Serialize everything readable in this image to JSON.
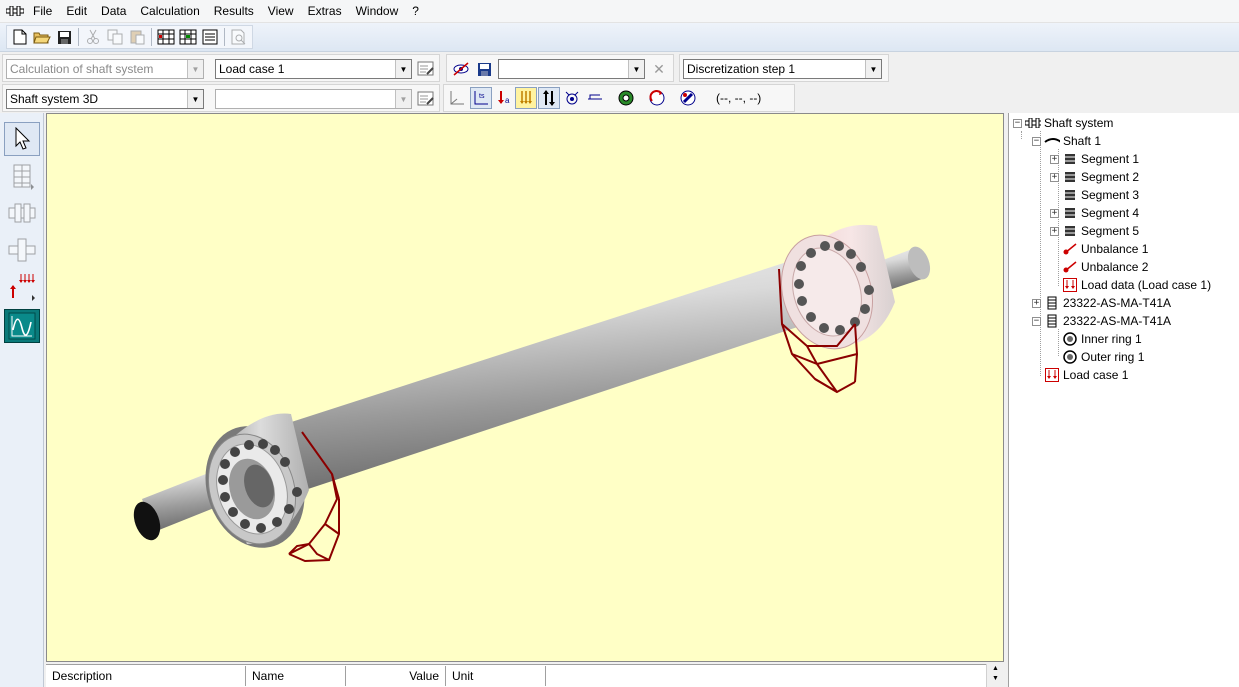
{
  "menu": {
    "items": [
      "File",
      "Edit",
      "Data",
      "Calculation",
      "Results",
      "View",
      "Extras",
      "Window",
      "?"
    ]
  },
  "toolbar2": {
    "calc_select": "Calculation of shaft system",
    "loadcase_select": "Load case 1",
    "third_select": "",
    "discretization_select": "Discretization step 1"
  },
  "toolbar3": {
    "view_select": "Shaft system 3D",
    "second_select": "",
    "coords": "(--, --, --)"
  },
  "icons": {
    "left_tools": [
      "pointer-icon",
      "shaft-editor-icon",
      "bearing-icon",
      "coupling-icon",
      "loads-icon",
      "results-graph-icon"
    ]
  },
  "table": {
    "headers": [
      "Description",
      "Name",
      "Value",
      "Unit"
    ]
  },
  "tree": {
    "root": "Shaft system",
    "shaft": "Shaft 1",
    "segments": [
      "Segment 1",
      "Segment 2",
      "Segment 3",
      "Segment 4",
      "Segment 5"
    ],
    "unbalances": [
      "Unbalance 1",
      "Unbalance 2"
    ],
    "load_data": "Load data (Load case 1)",
    "bearings": [
      "23322-AS-MA-T41A",
      "23322-AS-MA-T41A"
    ],
    "rings": [
      "Inner ring 1",
      "Outer ring 1"
    ],
    "load_case": "Load case 1"
  },
  "colors": {
    "viewport_bg": "#ffffc6",
    "bearing_load": "#8b0000"
  }
}
